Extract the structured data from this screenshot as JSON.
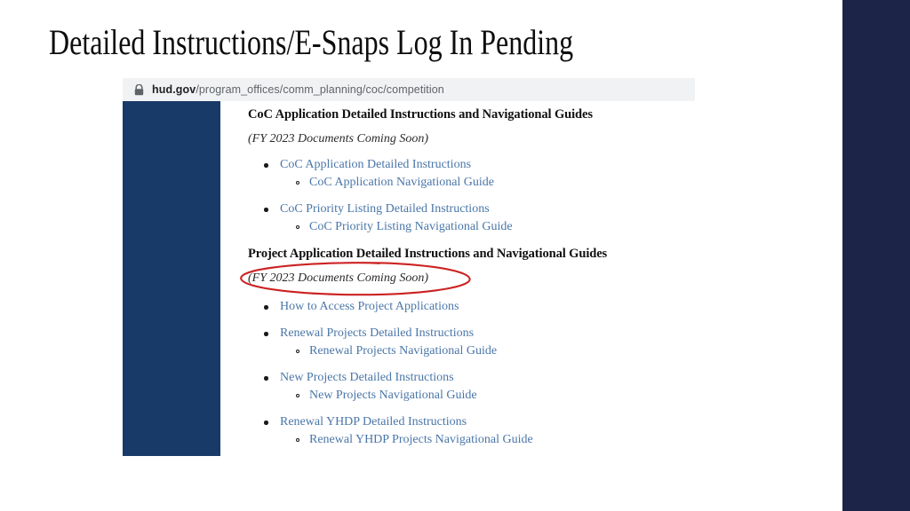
{
  "slide": {
    "title": "Detailed Instructions/E-Snaps Log In Pending",
    "background_color": "#ffffff",
    "title_color": "#0d0d0d",
    "right_panel_color": "#1c2448"
  },
  "browser": {
    "lock_icon": "lock-icon",
    "url_host": "hud.gov",
    "url_path": "/program_offices/comm_planning/coc/competition",
    "url_bar_background": "#f1f2f4"
  },
  "captured_page": {
    "sidebar_color": "#173a68",
    "link_color": "#4a76a8",
    "sections": [
      {
        "heading": "CoC Application Detailed Instructions and Navigational Guides",
        "note": "(FY 2023 Documents Coming Soon)",
        "annotated": false,
        "groups": [
          {
            "primary": "CoC Application Detailed Instructions",
            "secondary": "CoC Application Navigational Guide"
          },
          {
            "primary": "CoC Priority Listing Detailed Instructions",
            "secondary": "CoC Priority Listing Navigational Guide"
          }
        ]
      },
      {
        "heading": "Project Application Detailed Instructions and Navigational Guides",
        "note": "(FY 2023 Documents Coming Soon)",
        "annotated": true,
        "groups": [
          {
            "primary": "How to Access Project Applications",
            "secondary": ""
          },
          {
            "primary": "Renewal Projects Detailed Instructions",
            "secondary": "Renewal Projects Navigational Guide"
          },
          {
            "primary": "New Projects Detailed Instructions",
            "secondary": "New Projects Navigational Guide"
          },
          {
            "primary": "Renewal YHDP Detailed Instructions",
            "secondary": "Renewal YHDP Projects Navigational Guide"
          }
        ]
      }
    ]
  },
  "annotation": {
    "shape": "ellipse",
    "color": "#cc2222",
    "target_text": "(FY 2023 Documents Coming Soon)"
  }
}
